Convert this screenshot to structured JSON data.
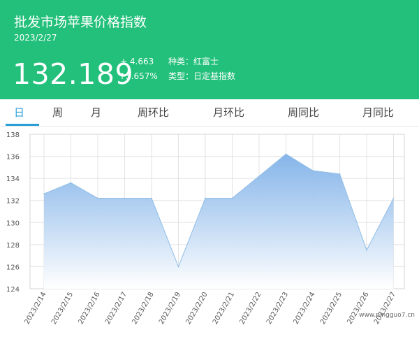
{
  "header": {
    "title": "批发市场苹果价格指数",
    "date": "2023/2/27",
    "index_value": "132.189",
    "change_abs": "+ 4.663",
    "change_pct": "↑3.657%",
    "variety_label": "种类：",
    "variety_value": "红富士",
    "type_label": "类型：",
    "type_value": "日定基指数",
    "bg_color": "#22c07a"
  },
  "tabs": [
    {
      "label": "日",
      "active": true
    },
    {
      "label": "周",
      "active": false
    },
    {
      "label": "月",
      "active": false
    },
    {
      "label": "周环比",
      "active": false
    },
    {
      "label": "月环比",
      "active": false
    },
    {
      "label": "周同比",
      "active": false
    },
    {
      "label": "月同比",
      "active": false
    }
  ],
  "chart_data": {
    "type": "area",
    "categories": [
      "2023/2/14",
      "2023/2/15",
      "2023/2/16",
      "2023/2/17",
      "2023/2/18",
      "2023/2/19",
      "2023/2/20",
      "2023/2/21",
      "2023/2/22",
      "2023/2/23",
      "2023/2/24",
      "2023/2/25",
      "2023/2/26",
      "2023/2/27"
    ],
    "values": [
      132.6,
      133.6,
      132.2,
      132.2,
      132.2,
      126.0,
      132.2,
      132.2,
      134.2,
      136.2,
      134.7,
      134.4,
      127.5,
      132.2
    ],
    "ylim": [
      124,
      138
    ],
    "yticks": [
      124,
      126,
      128,
      130,
      132,
      134,
      136,
      138
    ],
    "grid": true,
    "line_color": "#8fbde6",
    "fill_top_color": "#7fb1e8",
    "fill_bottom_color": "#ffffff"
  },
  "watermark": "www.pingguo7.cn"
}
